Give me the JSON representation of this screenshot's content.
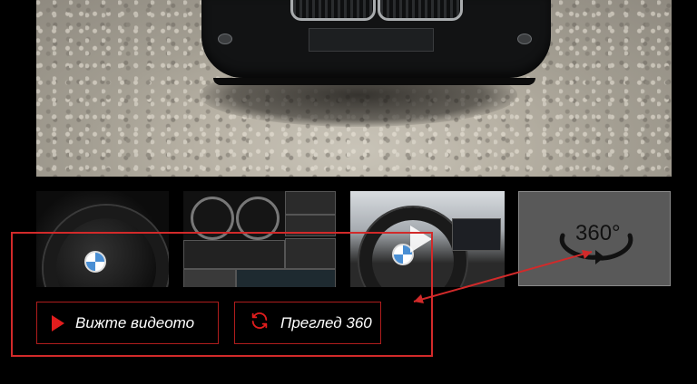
{
  "gallery": {
    "main_image": "car-front-photo",
    "thumbnails": [
      {
        "name": "steering-wheel-closeup"
      },
      {
        "name": "instrument-collage"
      },
      {
        "name": "cockpit-video",
        "icon": "play-icon"
      },
      {
        "name": "view-360",
        "icon": "rotate-360-icon",
        "label": "360°"
      }
    ]
  },
  "actions": {
    "video_label": "Вижте видеото",
    "view360_label": "Преглед 360"
  },
  "colors": {
    "background": "#000000",
    "accent": "#e11d1d",
    "button_border": "#b01d1d",
    "annotation": "#d22a2a"
  }
}
